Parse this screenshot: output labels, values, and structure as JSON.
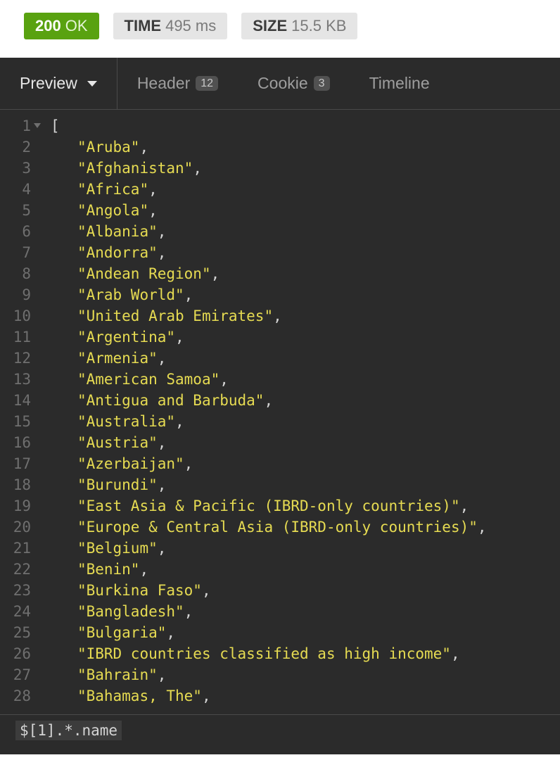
{
  "status": {
    "code": "200",
    "text": "OK",
    "time_label": "TIME",
    "time_value": "495 ms",
    "size_label": "SIZE",
    "size_value": "15.5 KB"
  },
  "tabs": {
    "preview": "Preview",
    "header": "Header",
    "header_count": "12",
    "cookie": "Cookie",
    "cookie_count": "3",
    "timeline": "Timeline"
  },
  "code": {
    "open_bracket": "[",
    "items": [
      "Aruba",
      "Afghanistan",
      "Africa",
      "Angola",
      "Albania",
      "Andorra",
      "Andean Region",
      "Arab World",
      "United Arab Emirates",
      "Argentina",
      "Armenia",
      "American Samoa",
      "Antigua and Barbuda",
      "Australia",
      "Austria",
      "Azerbaijan",
      "Burundi",
      "East Asia & Pacific (IBRD-only countries)",
      "Europe & Central Asia (IBRD-only countries)",
      "Belgium",
      "Benin",
      "Burkina Faso",
      "Bangladesh",
      "Bulgaria",
      "IBRD countries classified as high income",
      "Bahrain",
      "Bahamas, The"
    ]
  },
  "query": {
    "value": "$[1].*.name"
  },
  "line_numbers": [
    "1",
    "2",
    "3",
    "4",
    "5",
    "6",
    "7",
    "8",
    "9",
    "10",
    "11",
    "12",
    "13",
    "14",
    "15",
    "16",
    "17",
    "18",
    "19",
    "20",
    "21",
    "22",
    "23",
    "24",
    "25",
    "26",
    "27",
    "28"
  ]
}
